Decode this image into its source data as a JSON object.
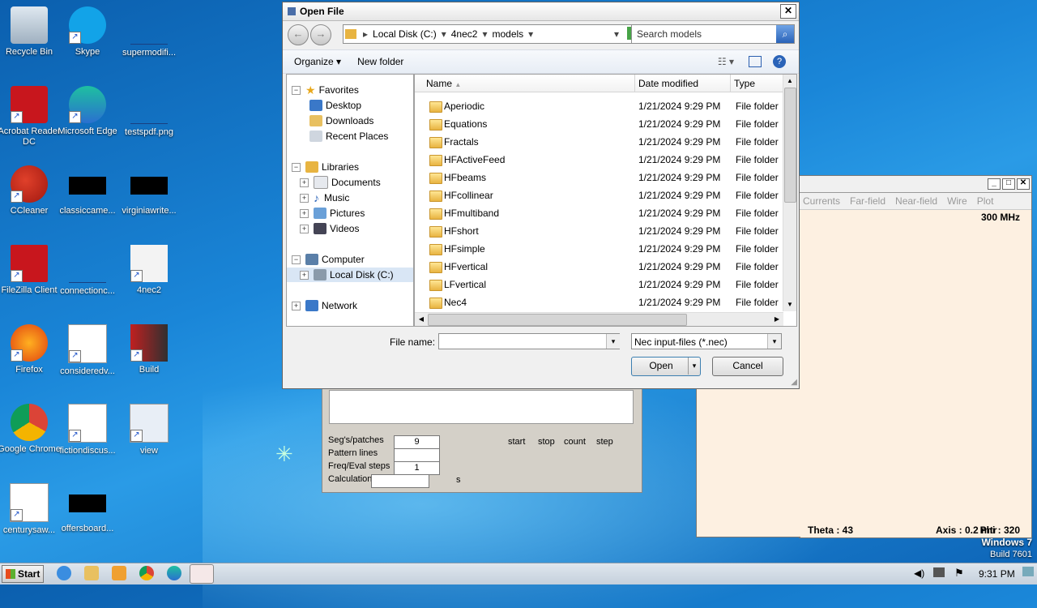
{
  "desktop": {
    "icons": [
      {
        "label": "Recycle Bin"
      },
      {
        "label": "Skype"
      },
      {
        "label": "supermodifi..."
      },
      {
        "label": "Acrobat Reader DC"
      },
      {
        "label": "Microsoft Edge"
      },
      {
        "label": "testspdf.png"
      },
      {
        "label": "CCleaner"
      },
      {
        "label": "classiccame..."
      },
      {
        "label": "virginiawrite..."
      },
      {
        "label": "FileZilla Client"
      },
      {
        "label": "connectionc..."
      },
      {
        "label": "4nec2"
      },
      {
        "label": "Firefox"
      },
      {
        "label": "consideredv..."
      },
      {
        "label": "Build"
      },
      {
        "label": "Google Chrome"
      },
      {
        "label": "fictiondiscus..."
      },
      {
        "label": "view"
      },
      {
        "label": "centurysaw..."
      },
      {
        "label": "offersboard..."
      }
    ],
    "os_name": "Windows 7",
    "os_build": "Build 7601"
  },
  "nec_window": {
    "menu": [
      "Currents",
      "Far-field",
      "Near-field",
      "Wire",
      "Plot"
    ],
    "freq": "300 MHz",
    "theta": "Theta : 43",
    "axis": "Axis : 0.2 mtr",
    "phi": "Phi : 320"
  },
  "calc_panel": {
    "segs_label": "Seg's/patches",
    "segs_value": "9",
    "pattern_label": "Pattern lines",
    "freq_label": "Freq/Eval steps",
    "freq_value": "1",
    "calc_label": "Calculation time",
    "calc_unit": "s",
    "col_start": "start",
    "col_stop": "stop",
    "col_count": "count",
    "col_step": "step"
  },
  "dialog": {
    "title": "Open File",
    "breadcrumb": [
      "Local Disk (C:)",
      "4nec2",
      "models"
    ],
    "search_placeholder": "Search models",
    "organize": "Organize",
    "new_folder": "New folder",
    "tree": {
      "favorites": "Favorites",
      "desktop": "Desktop",
      "downloads": "Downloads",
      "recent": "Recent Places",
      "libraries": "Libraries",
      "documents": "Documents",
      "music": "Music",
      "pictures": "Pictures",
      "videos": "Videos",
      "computer": "Computer",
      "local_disk": "Local Disk (C:)",
      "network": "Network"
    },
    "columns": {
      "name": "Name",
      "date": "Date modified",
      "type": "Type"
    },
    "files": [
      {
        "name": "Aperiodic",
        "date": "1/21/2024 9:29 PM",
        "type": "File folder"
      },
      {
        "name": "Equations",
        "date": "1/21/2024 9:29 PM",
        "type": "File folder"
      },
      {
        "name": "Fractals",
        "date": "1/21/2024 9:29 PM",
        "type": "File folder"
      },
      {
        "name": "HFActiveFeed",
        "date": "1/21/2024 9:29 PM",
        "type": "File folder"
      },
      {
        "name": "HFbeams",
        "date": "1/21/2024 9:29 PM",
        "type": "File folder"
      },
      {
        "name": "HFcollinear",
        "date": "1/21/2024 9:29 PM",
        "type": "File folder"
      },
      {
        "name": "HFmultiband",
        "date": "1/21/2024 9:29 PM",
        "type": "File folder"
      },
      {
        "name": "HFshort",
        "date": "1/21/2024 9:29 PM",
        "type": "File folder"
      },
      {
        "name": "HFsimple",
        "date": "1/21/2024 9:29 PM",
        "type": "File folder"
      },
      {
        "name": "HFvertical",
        "date": "1/21/2024 9:29 PM",
        "type": "File folder"
      },
      {
        "name": "LFvertical",
        "date": "1/21/2024 9:29 PM",
        "type": "File folder"
      },
      {
        "name": "Nec4",
        "date": "1/21/2024 9:29 PM",
        "type": "File folder"
      }
    ],
    "file_name_label": "File name:",
    "file_name_value": "",
    "file_type": "Nec input-files (*.nec)",
    "open_label": "Open",
    "cancel_label": "Cancel"
  },
  "taskbar": {
    "start": "Start",
    "time": "9:31 PM"
  }
}
